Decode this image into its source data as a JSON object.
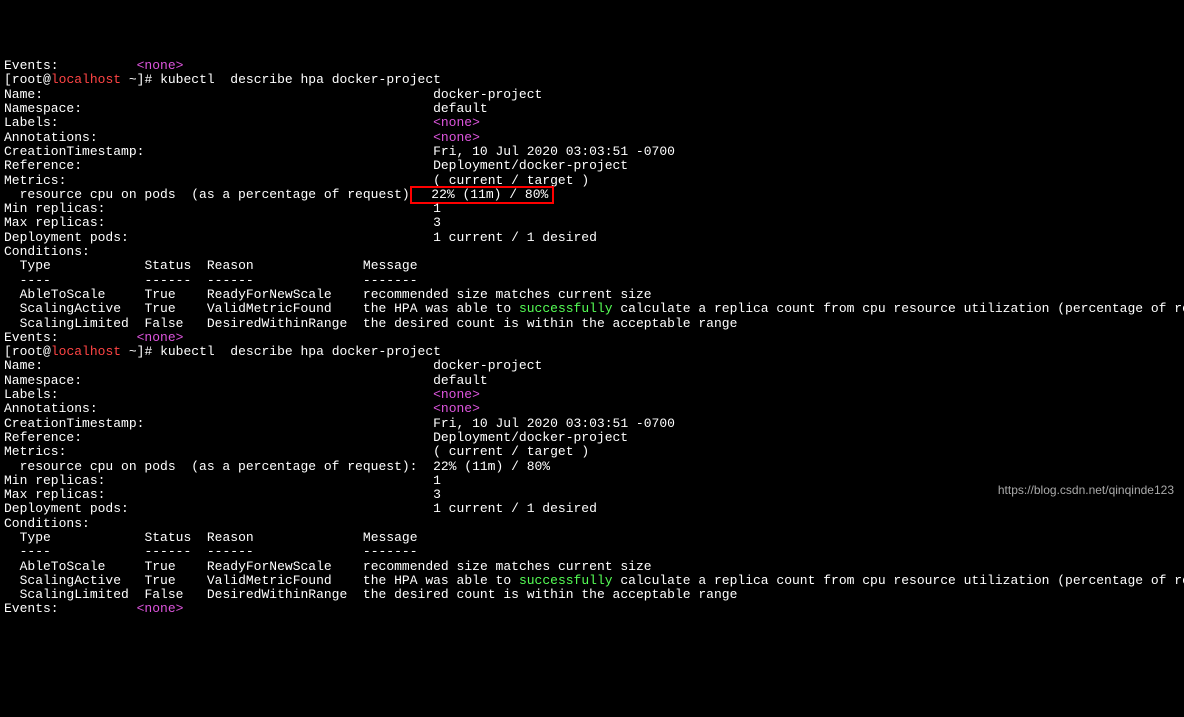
{
  "prompt": {
    "open_bracket": "[",
    "user": "root",
    "at": "@",
    "host": "localhost",
    "path": " ~]#",
    "command": " kubectl  describe hpa docker-project"
  },
  "block1": {
    "name_label": "Name:",
    "name_value": "docker-project",
    "namespace_label": "Namespace:",
    "namespace_value": "default",
    "labels_label": "Labels:",
    "none_value": "<none>",
    "annotations_label": "Annotations:",
    "creation_label": "CreationTimestamp:",
    "creation_value": "Fri, 10 Jul 2020 03:03:51 -0700",
    "reference_label": "Reference:",
    "reference_value": "Deployment/docker-project",
    "metrics_label": "Metrics:",
    "metrics_value": "( current / target )",
    "resource_line": "  resource cpu on pods  (as a percentage of request)",
    "resource_highlight": "  22% (11m) / 80%",
    "min_replicas_label": "Min replicas:",
    "min_replicas_value": "1",
    "max_replicas_label": "Max replicas:",
    "max_replicas_value": "3",
    "deployment_pods_label": "Deployment pods:",
    "deployment_pods_value": "1 current / 1 desired",
    "conditions_label": "Conditions:",
    "header_type": "  Type",
    "header_status": "Status",
    "header_reason": "Reason",
    "header_message": "Message",
    "dash_type": "  ----",
    "dash_status": "------",
    "dash_reason": "------",
    "dash_message": "-------",
    "row1_type": "  AbleToScale",
    "row1_status": "True",
    "row1_reason": "ReadyForNewScale",
    "row1_message": "recommended size matches current size",
    "row2_type": "  ScalingActive",
    "row2_status": "True",
    "row2_reason": "ValidMetricFound",
    "row2_msg_pre": "the HPA was able to ",
    "row2_msg_success": "successfully",
    "row2_msg_post": " calculate a replica count from cpu resource utilization (percentage of request)",
    "row3_type": "  ScalingLimited",
    "row3_status": "False",
    "row3_reason": "DesiredWithinRange",
    "row3_message": "the desired count is within the acceptable range",
    "events_label": "Events:"
  },
  "block2": {
    "resource_line": "  resource cpu on pods  (as a percentage of request):",
    "resource_value": "22% (11m) / 80%"
  },
  "watermark": "https://blog.csdn.net/qinqinde123"
}
